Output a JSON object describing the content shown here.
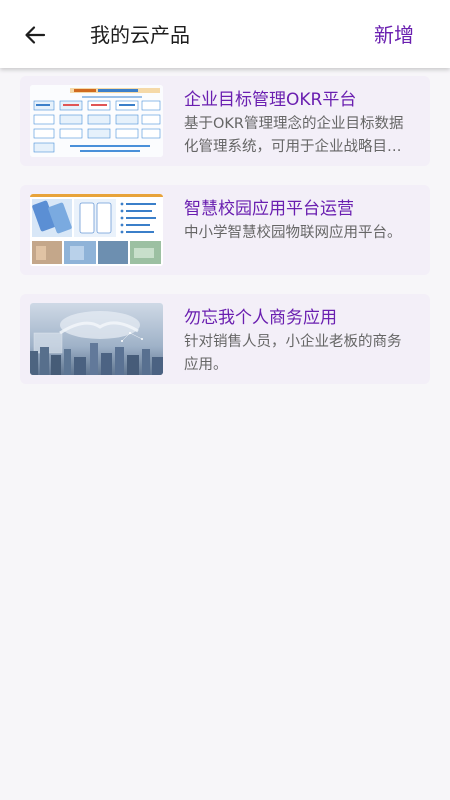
{
  "header": {
    "back_icon": "arrow-left-icon",
    "title": "我的云产品",
    "add_label": "新增"
  },
  "colors": {
    "accent": "#6a1fb0",
    "card_bg": "#f3eff8",
    "page_bg": "#f7f6f9",
    "desc_text": "#666666"
  },
  "products": [
    {
      "title": "企业目标管理OKR平台",
      "desc": "基于OKR管理理念的企业目标数据化管理系统，可用于企业战略目标管理等场景",
      "thumb": "okr-diagram-thumbnail"
    },
    {
      "title": "智慧校园应用平台运营",
      "desc": "中小学智慧校园物联网应用平台。",
      "thumb": "smart-campus-thumbnail"
    },
    {
      "title": "勿忘我个人商务应用",
      "desc": "针对销售人员，小企业老板的商务应用。",
      "thumb": "business-handshake-thumbnail"
    }
  ]
}
